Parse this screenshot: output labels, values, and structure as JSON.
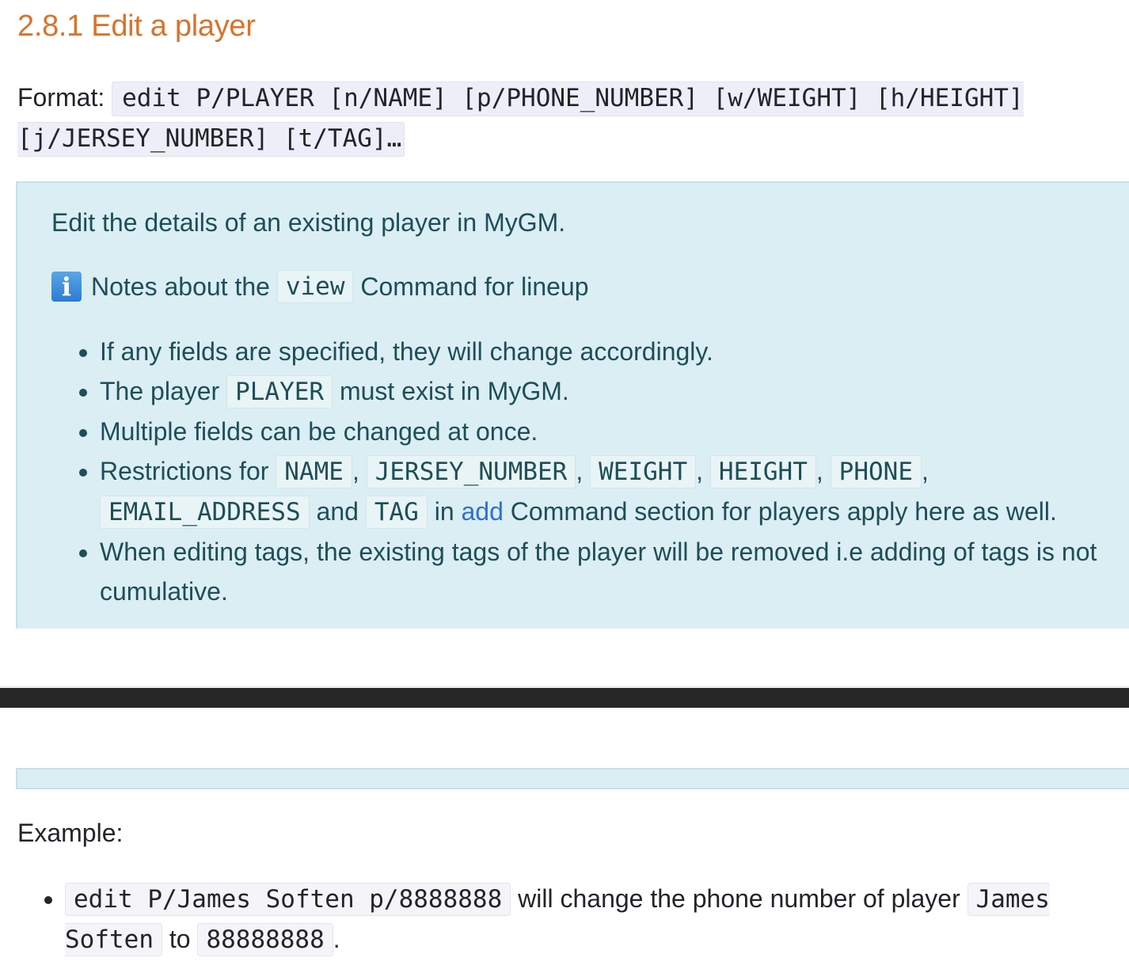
{
  "heading": "2.8.1 Edit a player",
  "format": {
    "label": "Format:",
    "command": "edit P/PLAYER [n/NAME] [p/PHONE_NUMBER] [w/WEIGHT] [h/HEIGHT] [j/JERSEY_NUMBER] [t/TAG]…"
  },
  "callout": {
    "intro": "Edit the details of an existing player in MyGM.",
    "note_prefix": "Notes about the",
    "note_code": "view",
    "note_suffix": "Command for lineup",
    "info_icon": "info-icon",
    "bullets": {
      "b1": "If any fields are specified, they will change accordingly.",
      "b2_prefix": "The player",
      "b2_code": "PLAYER",
      "b2_suffix": "must exist in MyGM.",
      "b3": "Multiple fields can be changed at once.",
      "b4_prefix": "Restrictions for",
      "b4_codes": [
        "NAME",
        "JERSEY_NUMBER",
        "WEIGHT",
        "HEIGHT",
        "PHONE",
        "EMAIL_ADDRESS",
        "TAG"
      ],
      "comma": ",",
      "and": "and",
      "in": "in",
      "b4_link": "add",
      "b4_suffix": "Command section for players apply here as well.",
      "b5": "When editing tags, the existing tags of the player will be removed i.e adding of tags is not cumulative."
    }
  },
  "example": {
    "label": "Example:",
    "item_code1": "edit P/James Soften p/8888888",
    "item_text1": "will change the phone number of player",
    "item_code2": "James Soften",
    "item_text2": "to",
    "item_code3": "88888888",
    "item_end": "."
  },
  "colors": {
    "heading": "#d9732c",
    "callout_bg": "#dbeef3",
    "callout_text": "#1e4e57",
    "link": "#2f6fd6",
    "divider": "#262626"
  }
}
